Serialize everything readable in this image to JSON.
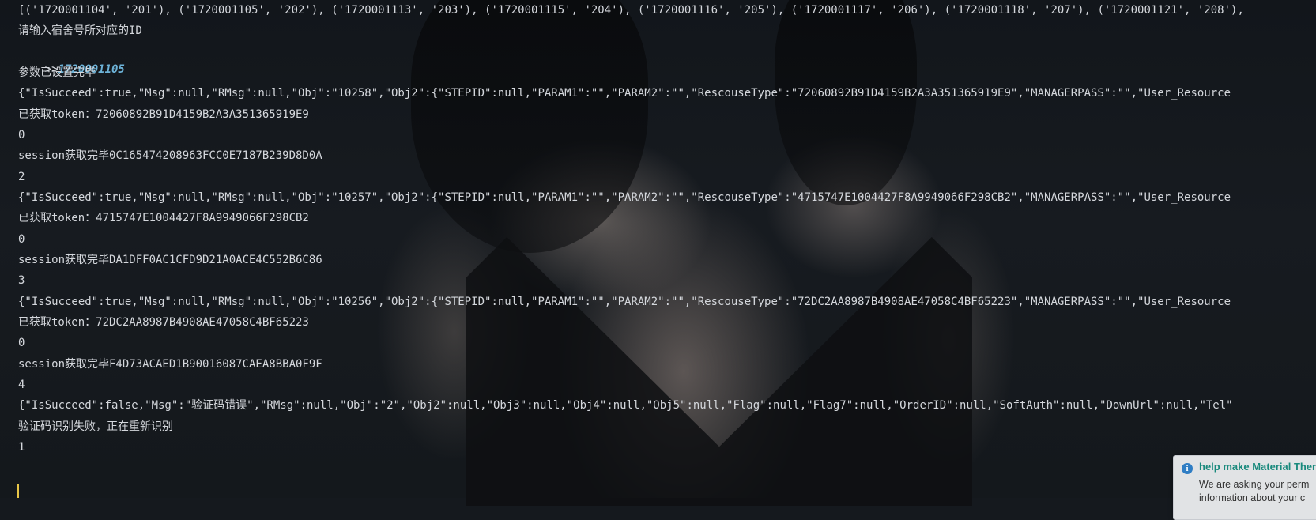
{
  "console": {
    "line_01": "[('1720001104', '201'), ('1720001105', '202'), ('1720001113', '203'), ('1720001115', '204'), ('1720001116', '205'), ('1720001117', '206'), ('1720001118', '207'), ('1720001121', '208'),",
    "line_02": "请输入宿舍号所对应的ID",
    "prompt_marker": ">>",
    "prompt_input": "1720001105",
    "line_04": "参数已设置完毕",
    "line_05": "{\"IsSucceed\":true,\"Msg\":null,\"RMsg\":null,\"Obj\":\"10258\",\"Obj2\":{\"STEPID\":null,\"PARAM1\":\"\",\"PARAM2\":\"\",\"RescouseType\":\"72060892B91D4159B2A3A351365919E9\",\"MANAGERPASS\":\"\",\"User_Resource",
    "line_06": "已获取token：72060892B91D4159B2A3A351365919E9",
    "line_07": "0",
    "line_08": "session获取完毕0C165474208963FCC0E7187B239D8D0A",
    "line_09": "2",
    "line_10": "{\"IsSucceed\":true,\"Msg\":null,\"RMsg\":null,\"Obj\":\"10257\",\"Obj2\":{\"STEPID\":null,\"PARAM1\":\"\",\"PARAM2\":\"\",\"RescouseType\":\"4715747E1004427F8A9949066F298CB2\",\"MANAGERPASS\":\"\",\"User_Resource",
    "line_11": "已获取token：4715747E1004427F8A9949066F298CB2",
    "line_12": "0",
    "line_13": "session获取完毕DA1DFF0AC1CFD9D21A0ACE4C552B6C86",
    "line_14": "3",
    "line_15": "{\"IsSucceed\":true,\"Msg\":null,\"RMsg\":null,\"Obj\":\"10256\",\"Obj2\":{\"STEPID\":null,\"PARAM1\":\"\",\"PARAM2\":\"\",\"RescouseType\":\"72DC2AA8987B4908AE47058C4BF65223\",\"MANAGERPASS\":\"\",\"User_Resource",
    "line_16": "已获取token：72DC2AA8987B4908AE47058C4BF65223",
    "line_17": "0",
    "line_18": "session获取完毕F4D73ACAED1B90016087CAEA8BBA0F9F",
    "line_19": "4",
    "line_20": "{\"IsSucceed\":false,\"Msg\":\"验证码错误\",\"RMsg\":null,\"Obj\":\"2\",\"Obj2\":null,\"Obj3\":null,\"Obj4\":null,\"Obj5\":null,\"Flag\":null,\"Flag7\":null,\"OrderID\":null,\"SoftAuth\":null,\"DownUrl\":null,\"Tel\"",
    "line_21": "验证码识别失败，正在重新识别",
    "line_22": "1"
  },
  "notification": {
    "icon": "info-icon",
    "icon_glyph": "i",
    "title": "help make Material Ther",
    "body_line_1": "We are asking your perm",
    "body_line_2": "information about your c"
  },
  "colors": {
    "console_text": "#d4d7dc",
    "input_text": "#6db3d8",
    "caret": "#e8c547",
    "notification_title": "#1a8a7d"
  }
}
